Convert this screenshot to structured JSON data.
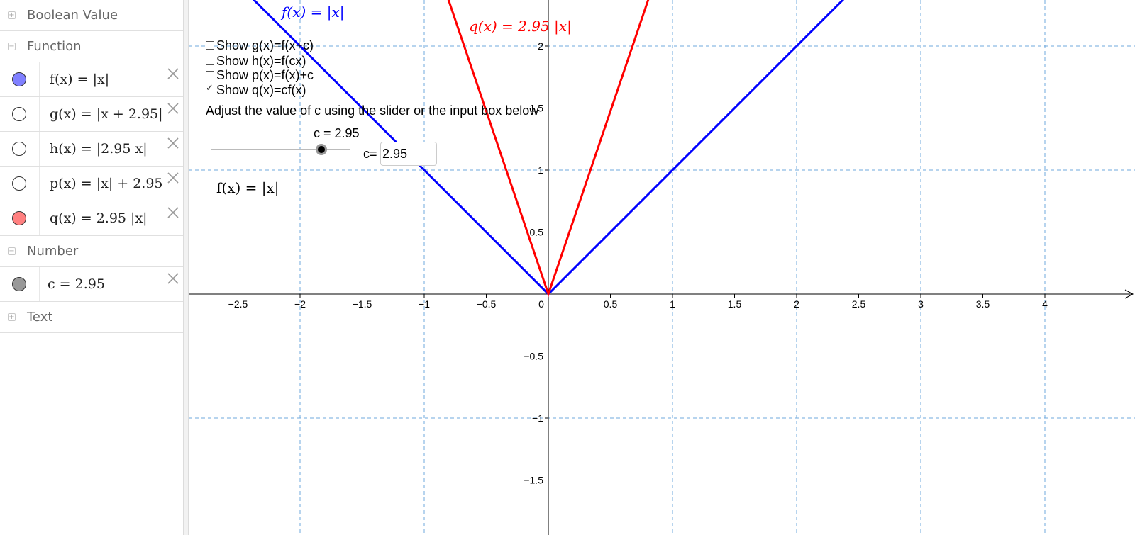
{
  "algebra": {
    "groups": {
      "boolean": {
        "label": "Boolean Value",
        "toggle": "+"
      },
      "function": {
        "label": "Function",
        "toggle": "−"
      },
      "number": {
        "label": "Number",
        "toggle": "−"
      },
      "text": {
        "label": "Text",
        "toggle": "+"
      }
    },
    "functions": [
      {
        "text": "f(x) = |x|",
        "visible": true,
        "color": "#8080ff"
      },
      {
        "text": "g(x) = |x + 2.95|",
        "visible": false,
        "color": "#ffffff"
      },
      {
        "text": "h(x) = |2.95 x|",
        "visible": false,
        "color": "#ffffff"
      },
      {
        "text": "p(x) = |x| + 2.95",
        "visible": false,
        "color": "#ffffff"
      },
      {
        "text": "q(x) = 2.95 |x|",
        "visible": true,
        "color": "#ff8080"
      }
    ],
    "numbers": [
      {
        "text": "c = 2.95",
        "visible": true,
        "color": "#999999"
      }
    ]
  },
  "graphics": {
    "checkboxes": [
      {
        "label": "Show g(x)=f(x+c)",
        "checked": false
      },
      {
        "label": "Show h(x)=f(cx)",
        "checked": false
      },
      {
        "label": "Show p(x)=f(x)+c",
        "checked": false
      },
      {
        "label": "Show q(x)=cf(x)",
        "checked": true
      }
    ],
    "instruction": "Adjust the value of c using the slider or the input box below",
    "slider_label": "c = 2.95",
    "slider_value": 2.95,
    "input_label": "c=",
    "input_value": "2.95",
    "f_text": "f(x) = |x|",
    "label_f": "f(x)  =  |x|",
    "label_q": "q(x)  =  2.95 |x|",
    "colors": {
      "f": "#0000ff",
      "q": "#ff0000",
      "grid": "#6fa8dc",
      "axis": "#000000"
    }
  },
  "chart_data": {
    "type": "line",
    "xlim": [
      -2.9,
      4.5
    ],
    "ylim": [
      -1.85,
      2.4
    ],
    "x_ticks": [
      "−2.5",
      "−2",
      "−1.5",
      "−1",
      "−0.5",
      "0",
      "0.5",
      "1",
      "1.5",
      "2",
      "2.5",
      "3",
      "3.5",
      "4"
    ],
    "y_ticks": [
      "−1.5",
      "−1",
      "−0.5",
      "0.5",
      "1",
      "1.5",
      "2"
    ],
    "grid": true,
    "series": [
      {
        "name": "f(x) = |x|",
        "color": "#0000ff",
        "x": [
          -2.9,
          0,
          4.5
        ],
        "y": [
          2.9,
          0,
          4.5
        ]
      },
      {
        "name": "q(x) = 2.95 |x|",
        "color": "#ff0000",
        "x": [
          -0.9,
          0,
          0.9
        ],
        "y": [
          2.655,
          0,
          2.655
        ]
      }
    ]
  }
}
